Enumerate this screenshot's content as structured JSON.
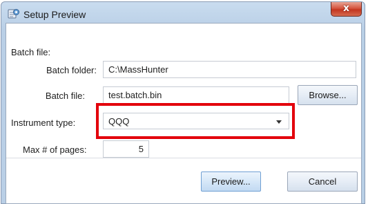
{
  "window": {
    "title": "Setup Preview",
    "close_glyph": "x"
  },
  "form": {
    "batch_section_label": "Batch file:",
    "batch_folder_label": "Batch folder:",
    "batch_folder_value": "C:\\MassHunter",
    "batch_file_label": "Batch file:",
    "batch_file_value": "test.batch.bin",
    "browse_label": "Browse...",
    "instrument_type_label": "Instrument type:",
    "instrument_type_value": "QQQ",
    "max_pages_label": "Max # of pages:",
    "max_pages_value": "5"
  },
  "footer": {
    "preview_label": "Preview...",
    "cancel_label": "Cancel"
  },
  "icons": {
    "app": "setup-preview-app-icon",
    "close": "close-icon",
    "dropdown": "chevron-down-icon"
  },
  "colors": {
    "highlight": "#e3000b",
    "close_button": "#c3361f"
  }
}
